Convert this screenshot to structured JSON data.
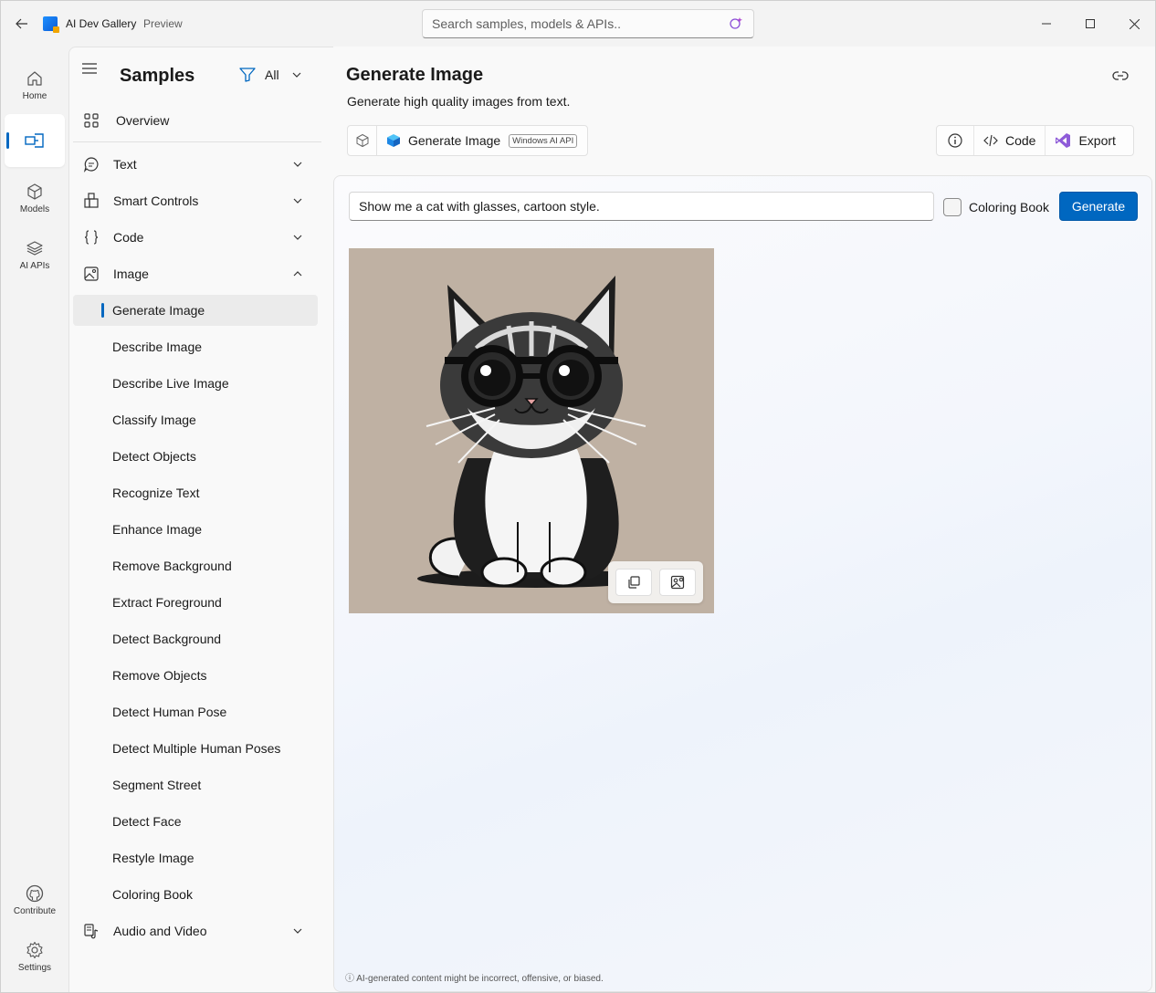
{
  "app": {
    "title": "AI Dev Gallery",
    "subtitle": "Preview"
  },
  "search": {
    "placeholder": "Search samples, models & APIs.."
  },
  "rail": {
    "home": "Home",
    "models": "Models",
    "ai_apis": "AI APIs",
    "contribute": "Contribute",
    "settings": "Settings"
  },
  "samples_pane": {
    "title": "Samples",
    "filter_label": "All",
    "overview": "Overview",
    "categories": {
      "text": "Text",
      "smart_controls": "Smart Controls",
      "code": "Code",
      "image": "Image",
      "audio_video": "Audio and Video"
    },
    "image_items": [
      "Generate Image",
      "Describe Image",
      "Describe Live Image",
      "Classify Image",
      "Detect Objects",
      "Recognize Text",
      "Enhance Image",
      "Remove Background",
      "Extract Foreground",
      "Detect Background",
      "Remove Objects",
      "Detect Human Pose",
      "Detect Multiple Human Poses",
      "Segment Street",
      "Detect Face",
      "Restyle Image",
      "Coloring Book"
    ],
    "selected_item": "Generate Image"
  },
  "content": {
    "title": "Generate Image",
    "description": "Generate high quality images from text.",
    "model_name": "Generate Image",
    "model_tag": "Windows AI API",
    "actions": {
      "code": "Code",
      "export": "Export"
    },
    "prompt_value": "Show me a cat with glasses, cartoon style.",
    "coloring_book_label": "Coloring Book",
    "coloring_book_checked": false,
    "generate_label": "Generate",
    "disclaimer": "AI-generated content might be incorrect, offensive, or biased."
  },
  "colors": {
    "accent": "#0067c0",
    "image_background": "#bfb1a3"
  }
}
